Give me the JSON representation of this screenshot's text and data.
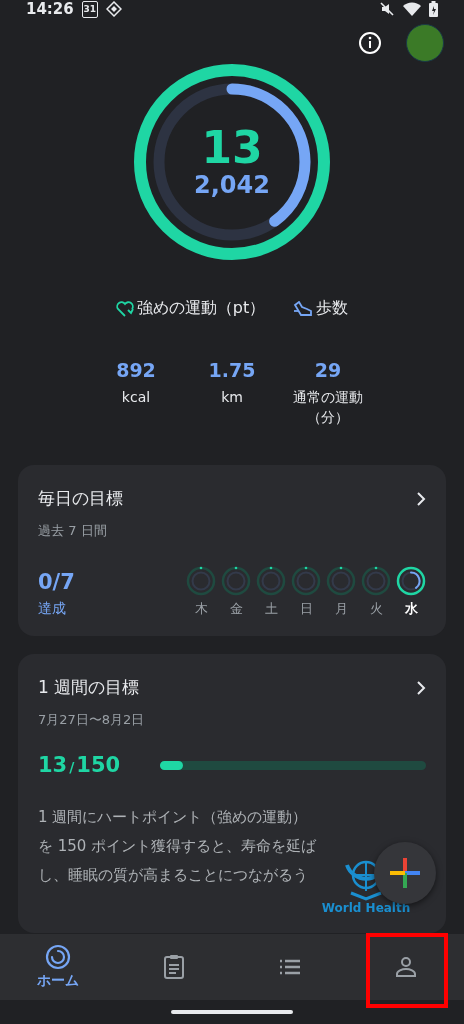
{
  "status_bar": {
    "time": "14:26",
    "calendar_day": "31"
  },
  "ring": {
    "heart": {
      "value": "13",
      "level": 1
    },
    "steps": {
      "value": "2,042",
      "level": 0.4
    }
  },
  "legend": [
    {
      "kind": "heart",
      "label": "強めの運動（pt）"
    },
    {
      "kind": "steps",
      "label": "歩数"
    }
  ],
  "stats": [
    {
      "value": "892",
      "label": "kcal"
    },
    {
      "value": "1.75",
      "label": "km"
    },
    {
      "value": "29",
      "label": "通常の運動（分）"
    }
  ],
  "daily_goal": {
    "title": "毎日の目標",
    "subtitle": "過去 7 日間",
    "score": "0/7",
    "score_label": "達成",
    "days": [
      {
        "label": "木",
        "selected": false
      },
      {
        "label": "金",
        "selected": false
      },
      {
        "label": "土",
        "selected": false
      },
      {
        "label": "日",
        "selected": false
      },
      {
        "label": "月",
        "selected": false
      },
      {
        "label": "火",
        "selected": false
      },
      {
        "label": "水",
        "selected": true
      }
    ]
  },
  "weekly_goal": {
    "title": "1 週間の目標",
    "dates": "7月27日〜8月2日",
    "score": "13",
    "separator": "/",
    "target": "150",
    "level": 0.087,
    "description": "1 週間にハートポイント（強めの運動）を 150 ポイント獲得すると、寿命を延ばし、睡眠の質が高まることにつながるう",
    "logo_text": "World Health"
  },
  "nav": [
    {
      "kind": "home",
      "label": "ホーム",
      "selected": true,
      "highlighted": false
    },
    {
      "kind": "journal",
      "selected": false,
      "highlighted": false
    },
    {
      "kind": "browse",
      "selected": false,
      "highlighted": false
    },
    {
      "kind": "profile",
      "selected": false,
      "highlighted": true
    }
  ]
}
